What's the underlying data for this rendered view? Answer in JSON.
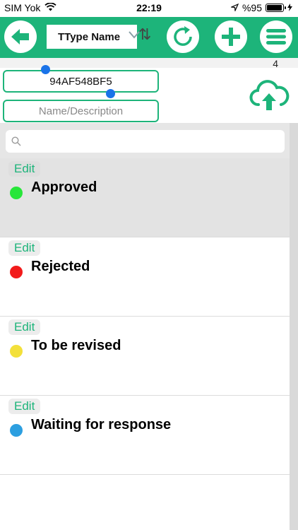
{
  "status_bar": {
    "carrier": "SIM Yok",
    "time": "22:19",
    "battery_text": "%95",
    "battery_level": 0.95
  },
  "toolbar": {
    "title": "TType Name",
    "sort_glyph": "⇅",
    "icons": [
      "back-arrow-icon",
      "refresh-icon",
      "plus-icon",
      "menu-icon"
    ]
  },
  "header": {
    "record_count": "4",
    "id_value": "94AF548BF5",
    "name_placeholder": "Name/Description",
    "upload_icon": "cloud-upload-icon"
  },
  "search": {
    "placeholder": ""
  },
  "list": {
    "edit_label": "Edit",
    "items": [
      {
        "label": "Approved",
        "color": "#27e639",
        "selected": true
      },
      {
        "label": "Rejected",
        "color": "#f21b1b",
        "selected": false
      },
      {
        "label": "To be revised",
        "color": "#f3e03a",
        "selected": false
      },
      {
        "label": "Waiting for response",
        "color": "#2c9fe0",
        "selected": false
      }
    ]
  },
  "colors": {
    "accent": "#1db47a"
  }
}
